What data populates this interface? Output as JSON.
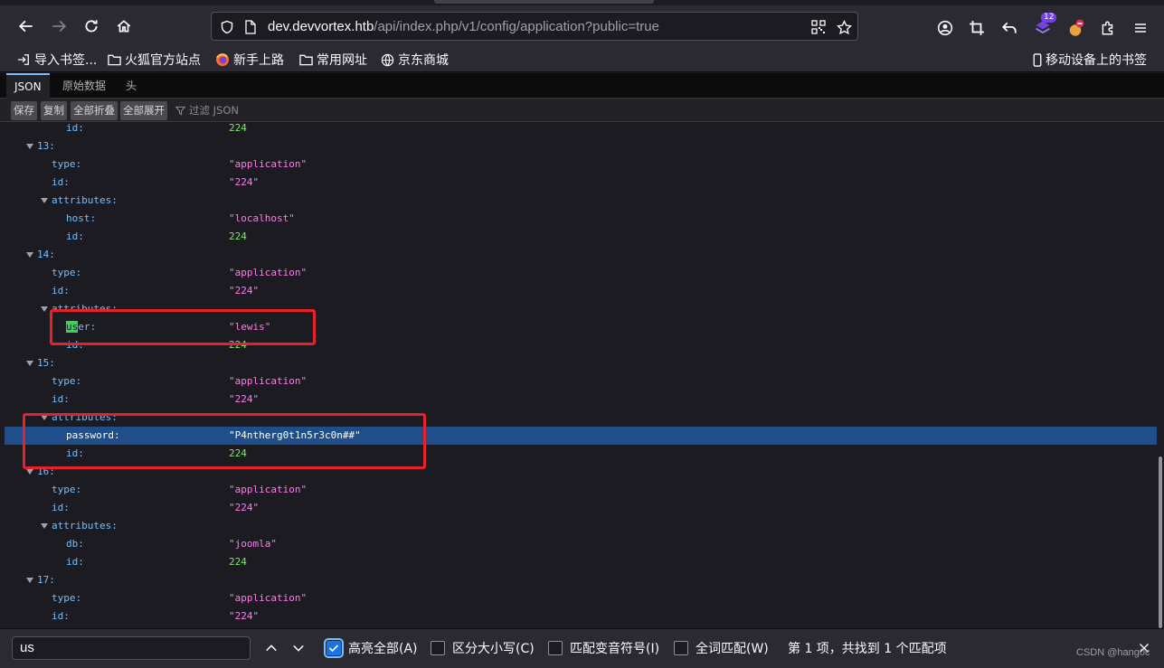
{
  "browser": {
    "url_host": "dev.devvortex.htb",
    "url_rest": "/api/index.php/v1/config/application?public=true",
    "extension_badge": "12"
  },
  "bookmarks": [
    {
      "label": "导入书签...",
      "icon": "import-icon"
    },
    {
      "label": "火狐官方站点",
      "icon": "folder-icon"
    },
    {
      "label": "新手上路",
      "icon": "firefox-icon"
    },
    {
      "label": "常用网址",
      "icon": "folder-icon"
    },
    {
      "label": "京东商城",
      "icon": "globe-icon"
    }
  ],
  "mobile_bookmarks": "移动设备上的书签",
  "json_viewer": {
    "tabs": [
      "JSON",
      "原始数据",
      "头"
    ],
    "buttons": [
      "保存",
      "复制",
      "全部折叠",
      "全部展开"
    ],
    "filter_placeholder": "过滤 JSON"
  },
  "rows": [
    {
      "indent": 2,
      "key": "id:",
      "value": "224",
      "type": "num"
    },
    {
      "indent": 0,
      "key": "13:",
      "twisty": true
    },
    {
      "indent": 1,
      "key": "type:",
      "value": "\"application\"",
      "type": "str"
    },
    {
      "indent": 1,
      "key": "id:",
      "value": "\"224\"",
      "type": "str"
    },
    {
      "indent": 1,
      "key": "attributes:",
      "twisty": true
    },
    {
      "indent": 2,
      "key": "host:",
      "value": "\"localhost\"",
      "type": "str"
    },
    {
      "indent": 2,
      "key": "id:",
      "value": "224",
      "type": "num"
    },
    {
      "indent": 0,
      "key": "14:",
      "twisty": true
    },
    {
      "indent": 1,
      "key": "type:",
      "value": "\"application\"",
      "type": "str"
    },
    {
      "indent": 1,
      "key": "id:",
      "value": "\"224\"",
      "type": "str"
    },
    {
      "indent": 1,
      "key": "attributes:",
      "twisty": true
    },
    {
      "indent": 2,
      "key": "user:",
      "value": "\"lewis\"",
      "type": "str",
      "highlight": "us"
    },
    {
      "indent": 2,
      "key": "id:",
      "value": "224",
      "type": "num"
    },
    {
      "indent": 0,
      "key": "15:",
      "twisty": true
    },
    {
      "indent": 1,
      "key": "type:",
      "value": "\"application\"",
      "type": "str"
    },
    {
      "indent": 1,
      "key": "id:",
      "value": "\"224\"",
      "type": "str"
    },
    {
      "indent": 1,
      "key": "attributes:",
      "twisty": true
    },
    {
      "indent": 2,
      "key": "password:",
      "value": "\"P4ntherg0t1n5r3c0n##\"",
      "type": "str",
      "selected": true
    },
    {
      "indent": 2,
      "key": "id:",
      "value": "224",
      "type": "num"
    },
    {
      "indent": 0,
      "key": "16:",
      "twisty": true
    },
    {
      "indent": 1,
      "key": "type:",
      "value": "\"application\"",
      "type": "str"
    },
    {
      "indent": 1,
      "key": "id:",
      "value": "\"224\"",
      "type": "str"
    },
    {
      "indent": 1,
      "key": "attributes:",
      "twisty": true
    },
    {
      "indent": 2,
      "key": "db:",
      "value": "\"joomla\"",
      "type": "str"
    },
    {
      "indent": 2,
      "key": "id:",
      "value": "224",
      "type": "num"
    },
    {
      "indent": 0,
      "key": "17:",
      "twisty": true
    },
    {
      "indent": 1,
      "key": "type:",
      "value": "\"application\"",
      "type": "str"
    },
    {
      "indent": 1,
      "key": "id:",
      "value": "\"224\"",
      "type": "str"
    }
  ],
  "find_bar": {
    "query": "us",
    "highlight_all": "高亮全部(A)",
    "match_case": "区分大小写(C)",
    "match_diacritics": "匹配变音符号(I)",
    "whole_words": "全词匹配(W)",
    "status": "第 1 项，共找到 1 个匹配项"
  },
  "watermark": "CSDN @hang0c"
}
